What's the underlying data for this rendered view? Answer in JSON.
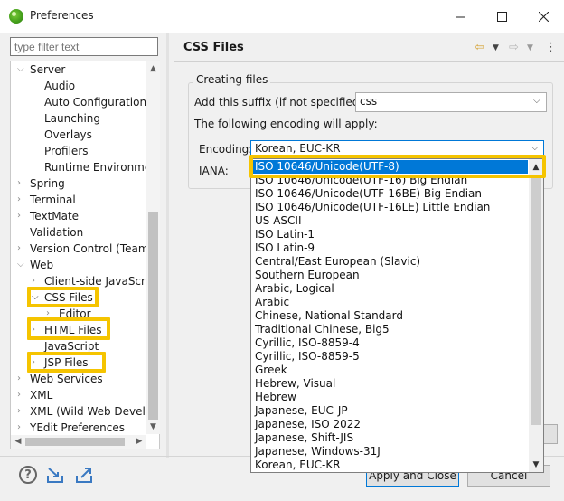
{
  "window": {
    "title": "Preferences"
  },
  "filter": {
    "placeholder": "type filter text"
  },
  "tree": {
    "server": "Server",
    "audio": "Audio",
    "auto_configuration": "Auto Configuration",
    "launching": "Launching",
    "overlays": "Overlays",
    "profilers": "Profilers",
    "runtime_environment": "Runtime Environmen",
    "spring": "Spring",
    "terminal": "Terminal",
    "textmate": "TextMate",
    "validation": "Validation",
    "version_control": "Version Control (Team)",
    "web": "Web",
    "client_side_javascript": "Client-side JavaScript",
    "css_files": "CSS Files",
    "editor": "Editor",
    "html_files": "HTML Files",
    "javascript": "JavaScript",
    "jsp_files": "JSP Files",
    "web_services": "Web Services",
    "xml": "XML",
    "xml_wild": "XML (Wild Web Develop",
    "yedit": "YEdit Preferences"
  },
  "page": {
    "title": "CSS Files"
  },
  "form": {
    "group_title": "Creating files",
    "suffix_label": "Add this suffix (if not specified):",
    "suffix_value": "css",
    "encoding_info": "The following encoding will apply:",
    "encoding_label": "Encoding:",
    "encoding_value": "Korean, EUC-KR",
    "iana_label": "IANA:"
  },
  "dropdown": {
    "options": [
      "ISO 10646/Unicode(UTF-8)",
      "ISO 10646/Unicode(UTF-16) Big Endian",
      "ISO 10646/Unicode(UTF-16BE) Big Endian",
      "ISO 10646/Unicode(UTF-16LE) Little Endian",
      "US ASCII",
      "ISO Latin-1",
      "ISO Latin-9",
      "Central/East European (Slavic)",
      "Southern European",
      "Arabic, Logical",
      "Arabic",
      "Chinese, National Standard",
      "Traditional Chinese, Big5",
      "Cyrillic, ISO-8859-4",
      "Cyrillic, ISO-8859-5",
      "Greek",
      "Hebrew, Visual",
      "Hebrew",
      "Japanese, EUC-JP",
      "Japanese, ISO 2022",
      "Japanese, Shift-JIS",
      "Japanese, Windows-31J",
      "Korean, EUC-KR"
    ]
  },
  "buttons": {
    "apply_close": "Apply and Close",
    "cancel": "Cancel"
  },
  "colors": {
    "selection": "#0078d7",
    "highlight": "#f5c400"
  }
}
